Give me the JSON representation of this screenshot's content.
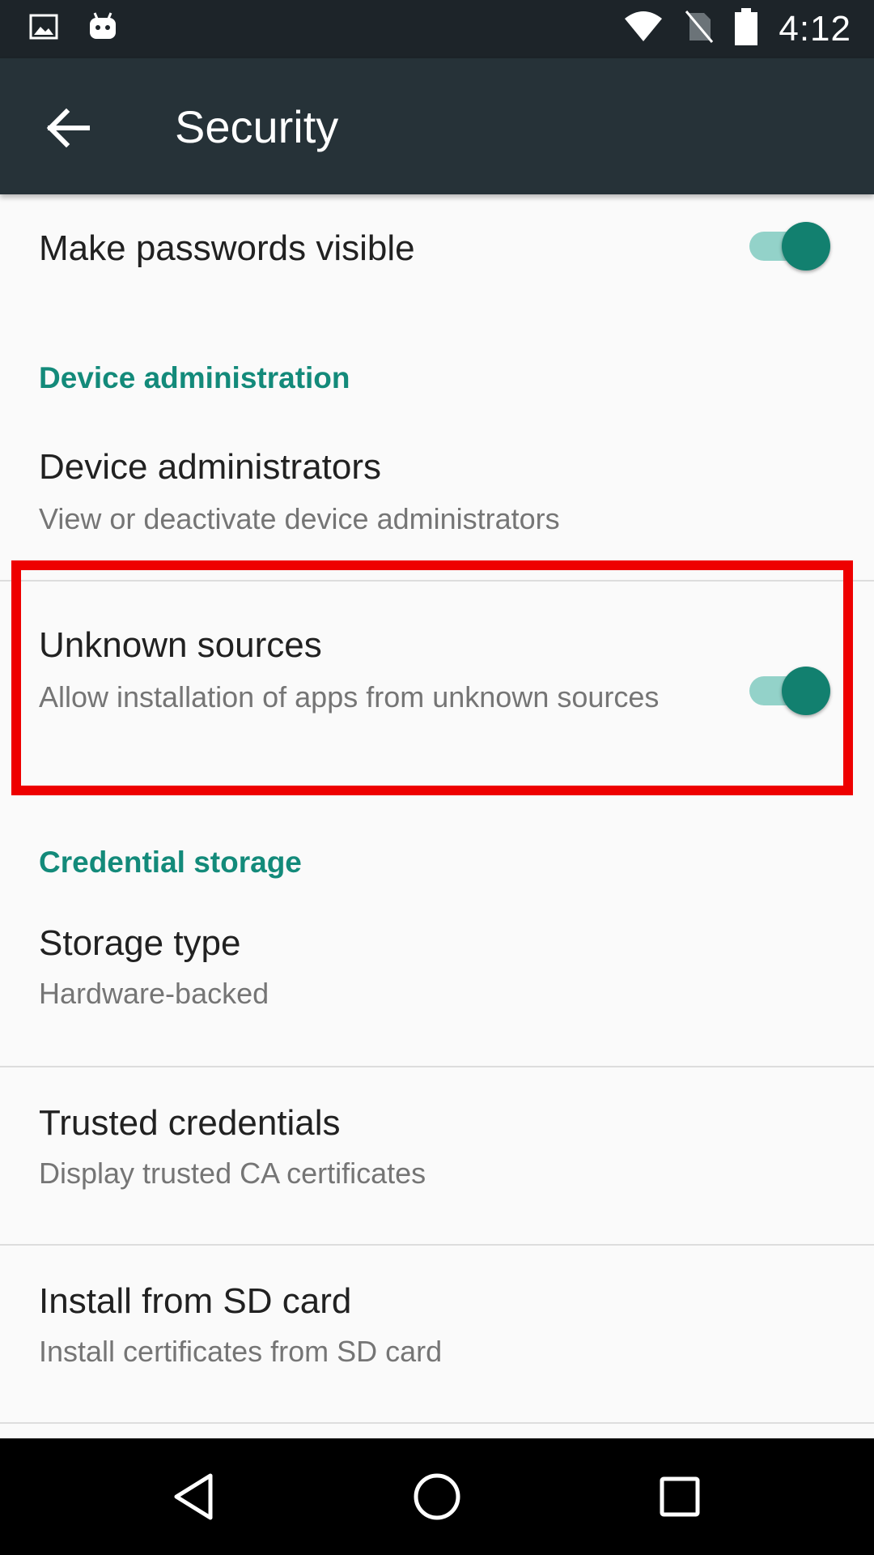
{
  "status_bar": {
    "time": "4:12",
    "left_icons": [
      "image-notification-icon",
      "android-notification-icon"
    ],
    "right_icons": [
      "wifi-icon",
      "no-sim-icon",
      "battery-icon"
    ]
  },
  "app_bar": {
    "title": "Security",
    "back_icon": "arrow-back-icon"
  },
  "settings": {
    "make_passwords_visible": {
      "title": "Make passwords visible",
      "enabled": true
    },
    "device_administration_header": "Device administration",
    "device_administrators": {
      "title": "Device administrators",
      "summary": "View or deactivate device administrators"
    },
    "unknown_sources": {
      "title": "Unknown sources",
      "summary": "Allow installation of apps from unknown sources",
      "enabled": true
    },
    "credential_storage_header": "Credential storage",
    "storage_type": {
      "title": "Storage type",
      "summary": "Hardware-backed"
    },
    "trusted_credentials": {
      "title": "Trusted credentials",
      "summary": "Display trusted CA certificates"
    },
    "install_from_sd": {
      "title": "Install from SD card",
      "summary": "Install certificates from SD card"
    }
  },
  "highlight": {
    "target": "unknown_sources",
    "color": "#ee0000"
  },
  "nav_bar": {
    "buttons": [
      "back-triangle-icon",
      "home-circle-icon",
      "recents-square-icon"
    ]
  },
  "colors": {
    "accent": "#138a7a",
    "switch_thumb": "#12806f",
    "switch_track": "#93d2c9",
    "app_bar": "#263238",
    "status_bar": "#1d2429"
  }
}
